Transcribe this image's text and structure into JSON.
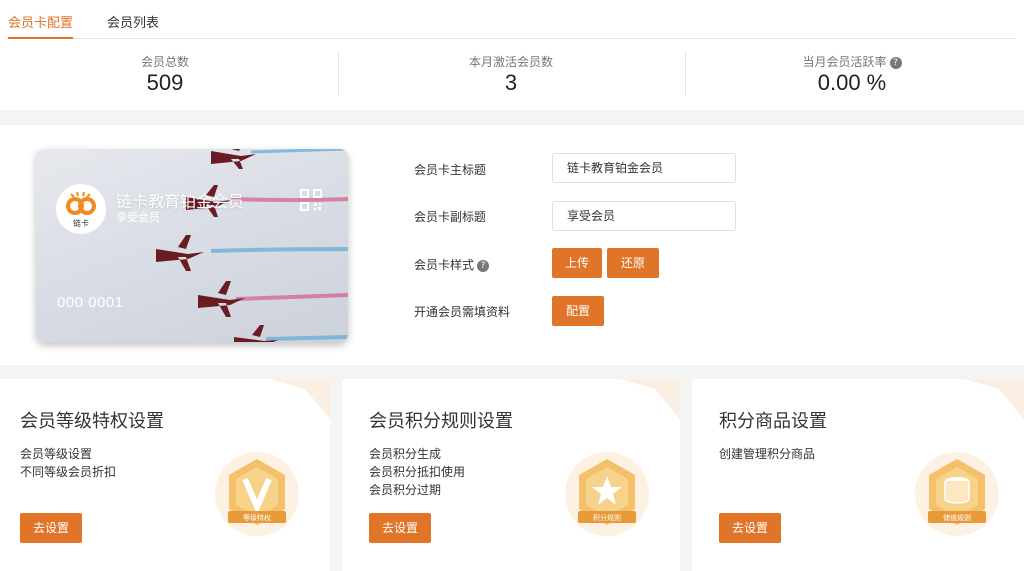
{
  "tabs": [
    {
      "label": "会员卡配置",
      "active": true
    },
    {
      "label": "会员列表",
      "active": false
    }
  ],
  "stats": [
    {
      "label": "会员总数",
      "value": "509"
    },
    {
      "label": "本月激活会员数",
      "value": "3"
    },
    {
      "label": "当月会员活跃率",
      "value": "0.00 %",
      "help_icon": "question-circle-icon"
    }
  ],
  "card": {
    "title": "链卡教育铂金会员",
    "subtitle": "享受会员",
    "number": "000 0001",
    "logo_text": "链卡",
    "qr_icon": "qr-code-icon"
  },
  "form": {
    "main_title_label": "会员卡主标题",
    "main_title_value": "链卡教育铂金会员",
    "sub_title_label": "会员卡副标题",
    "sub_title_value": "享受会员",
    "style_label": "会员卡样式",
    "upload_label": "上传",
    "restore_label": "还原",
    "required_info_label": "开通会员需填资料",
    "configure_label": "配置"
  },
  "panels": [
    {
      "title": "会员等级特权设置",
      "lines": [
        "会员等级设置",
        "不同等级会员折扣"
      ],
      "button": "去设置",
      "badge_text": "等级特权",
      "badge_icon": "v-badge-icon"
    },
    {
      "title": "会员积分规则设置",
      "lines": [
        "会员积分生成",
        "会员积分抵扣使用",
        "会员积分过期"
      ],
      "button": "去设置",
      "badge_text": "积分规则",
      "badge_icon": "star-badge-icon"
    },
    {
      "title": "积分商品设置",
      "lines": [
        "创建管理积分商品"
      ],
      "button": "去设置",
      "badge_text": "储值规则",
      "badge_icon": "coins-badge-icon"
    }
  ],
  "colors": {
    "accent": "#e0752a",
    "badge_gold": "#f2b24a"
  }
}
